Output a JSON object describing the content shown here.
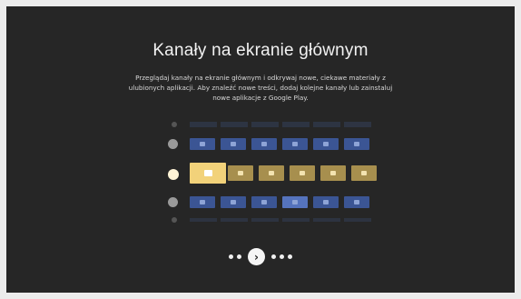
{
  "screen": {
    "title": "Kanały na ekranie głównym",
    "description_line1": "Przeglądaj kanały na ekranie głównym i odkrywaj nowe, ciekawe materiały z",
    "description_line2": "ulubionych aplikacji. Aby znaleźć nowe treści, dodaj kolejne kanały lub zainstaluj",
    "description_line3": "nowe aplikacje z Google Play."
  },
  "channels": [
    {
      "name": "play-channel",
      "icon": "play-icon",
      "tile_color": "#3b5594",
      "icon_color": "#8ea4d6",
      "tiles": 6
    },
    {
      "name": "store-channel",
      "icon": "shop-icon",
      "tile_color": "#a78f4e",
      "icon_color": "#f3e3b0",
      "highlight_color": "#f2d27a",
      "tiles": 6,
      "focused": true
    },
    {
      "name": "games-channel",
      "icon": "gamepad-icon",
      "tile_color": "#3b5594",
      "icon_color": "#8ea4d6",
      "highlight_color": "#5573bd",
      "tiles": 6
    }
  ],
  "pager": {
    "pages_before": 2,
    "pages_after": 3,
    "next_icon": "chevron-right-icon",
    "next_glyph": "›"
  },
  "colors": {
    "background": "#262626",
    "focus_dot": "#fff4d6",
    "inactive_dot": "#9a9a9a"
  }
}
